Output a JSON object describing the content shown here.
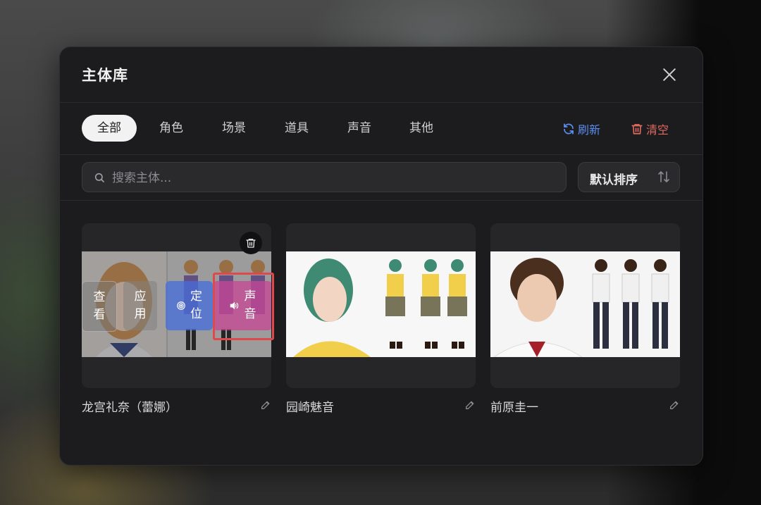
{
  "dialog": {
    "title": "主体库"
  },
  "tabs": [
    {
      "label": "全部",
      "active": true
    },
    {
      "label": "角色",
      "active": false
    },
    {
      "label": "场景",
      "active": false
    },
    {
      "label": "道具",
      "active": false
    },
    {
      "label": "声音",
      "active": false
    },
    {
      "label": "其他",
      "active": false
    }
  ],
  "actions": {
    "refresh_label": "刷新",
    "clear_label": "清空"
  },
  "search": {
    "placeholder": "搜索主体...",
    "value": ""
  },
  "sort": {
    "label": "默认排序"
  },
  "cards": [
    {
      "name": "龙宫礼奈（蕾娜）",
      "hover": true,
      "overlay": {
        "view": [
          "查",
          "看"
        ],
        "apply": [
          "应",
          "用"
        ],
        "locate": [
          "定",
          "位"
        ],
        "voice": [
          "声",
          "音"
        ]
      }
    },
    {
      "name": "园崎魅音",
      "hover": false
    },
    {
      "name": "前原圭一",
      "hover": false
    }
  ],
  "colors": {
    "accent_blue": "#5b8def",
    "danger_red": "#e06a5f",
    "highlight_red": "#e0494b"
  }
}
